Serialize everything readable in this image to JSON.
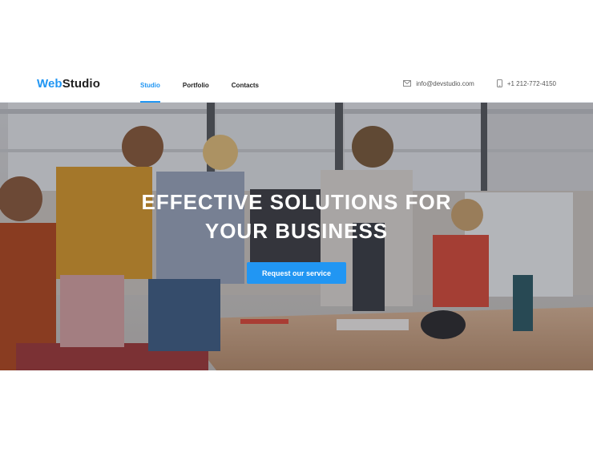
{
  "header": {
    "logo": {
      "part1": "Web",
      "part2": "Studio"
    },
    "nav": [
      {
        "label": "Studio",
        "active": true
      },
      {
        "label": "Portfolio",
        "active": false
      },
      {
        "label": "Contacts",
        "active": false
      }
    ],
    "contacts": {
      "email": "info@devstudio.com",
      "phone": "+1 212-772-4150"
    }
  },
  "hero": {
    "title_line1": "Effective solutions for",
    "title_line2": "your business",
    "cta_label": "Request our service"
  },
  "colors": {
    "accent": "#2196f3",
    "text": "#212121",
    "muted": "#555555"
  },
  "icons": [
    "envelope-icon",
    "phone-icon"
  ]
}
